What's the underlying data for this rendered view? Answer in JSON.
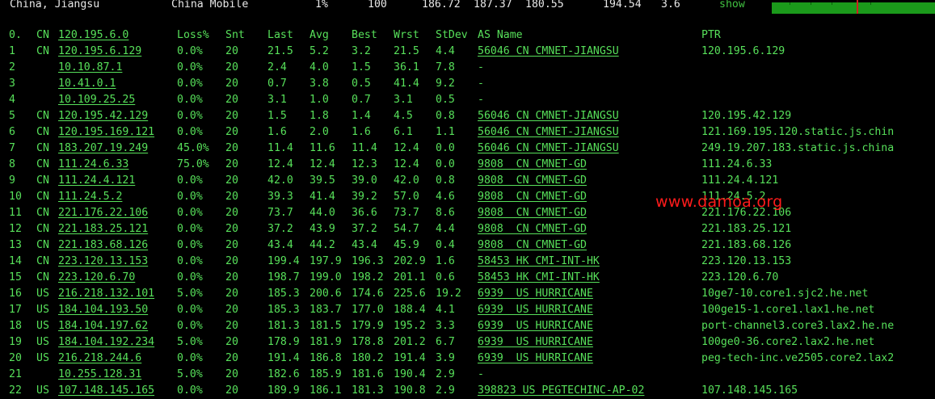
{
  "top_row": {
    "location": "China, Jiangsu",
    "isp": "China Mobile",
    "loss": "1%",
    "sent": "100",
    "avg": "186.72",
    "best": "187.37",
    "worst": "180.55",
    "last": "194.54",
    "stdev": "3.6",
    "show_link": "show"
  },
  "header": {
    "hop": "0.",
    "cc": "CN",
    "host": "120.195.6.0",
    "loss": "Loss%",
    "snt": "Snt",
    "last": "Last",
    "avg": "Avg",
    "best": "Best",
    "wrst": "Wrst",
    "stdev": "StDev",
    "as_name": "AS Name",
    "ptr": "PTR"
  },
  "hops": [
    {
      "hop": "1",
      "cc": "CN",
      "host": "120.195.6.129",
      "loss": "0.0%",
      "snt": "20",
      "last": "21.5",
      "avg": "5.2",
      "best": "3.2",
      "wrst": "21.5",
      "stdev": "4.4",
      "as_name": "56046 CN CMNET-JIANGSU",
      "ptr": "120.195.6.129"
    },
    {
      "hop": "2",
      "cc": "",
      "host": "10.10.87.1",
      "loss": "0.0%",
      "snt": "20",
      "last": "2.4",
      "avg": "4.0",
      "best": "1.5",
      "wrst": "36.1",
      "stdev": "7.8",
      "as_name": "-",
      "ptr": ""
    },
    {
      "hop": "3",
      "cc": "",
      "host": "10.41.0.1",
      "loss": "0.0%",
      "snt": "20",
      "last": "0.7",
      "avg": "3.8",
      "best": "0.5",
      "wrst": "41.4",
      "stdev": "9.2",
      "as_name": "-",
      "ptr": ""
    },
    {
      "hop": "4",
      "cc": "",
      "host": "10.109.25.25",
      "loss": "0.0%",
      "snt": "20",
      "last": "3.1",
      "avg": "1.0",
      "best": "0.7",
      "wrst": "3.1",
      "stdev": "0.5",
      "as_name": "-",
      "ptr": ""
    },
    {
      "hop": "5",
      "cc": "CN",
      "host": "120.195.42.129",
      "loss": "0.0%",
      "snt": "20",
      "last": "1.5",
      "avg": "1.8",
      "best": "1.4",
      "wrst": "4.5",
      "stdev": "0.8",
      "as_name": "56046 CN CMNET-JIANGSU",
      "ptr": "120.195.42.129"
    },
    {
      "hop": "6",
      "cc": "CN",
      "host": "120.195.169.121",
      "loss": "0.0%",
      "snt": "20",
      "last": "1.6",
      "avg": "2.0",
      "best": "1.6",
      "wrst": "6.1",
      "stdev": "1.1",
      "as_name": "56046 CN CMNET-JIANGSU",
      "ptr": "121.169.195.120.static.js.chin"
    },
    {
      "hop": "7",
      "cc": "CN",
      "host": "183.207.19.249",
      "loss": "45.0%",
      "snt": "20",
      "last": "11.4",
      "avg": "11.6",
      "best": "11.4",
      "wrst": "12.4",
      "stdev": "0.0",
      "as_name": "56046 CN CMNET-JIANGSU",
      "ptr": "249.19.207.183.static.js.china"
    },
    {
      "hop": "8",
      "cc": "CN",
      "host": "111.24.6.33",
      "loss": "75.0%",
      "snt": "20",
      "last": "12.4",
      "avg": "12.4",
      "best": "12.3",
      "wrst": "12.4",
      "stdev": "0.0",
      "as_name": "9808  CN CMNET-GD",
      "ptr": "111.24.6.33"
    },
    {
      "hop": "9",
      "cc": "CN",
      "host": "111.24.4.121",
      "loss": "0.0%",
      "snt": "20",
      "last": "42.0",
      "avg": "39.5",
      "best": "39.0",
      "wrst": "42.0",
      "stdev": "0.8",
      "as_name": "9808  CN CMNET-GD",
      "ptr": "111.24.4.121"
    },
    {
      "hop": "10",
      "cc": "CN",
      "host": "111.24.5.2",
      "loss": "0.0%",
      "snt": "20",
      "last": "39.3",
      "avg": "41.4",
      "best": "39.2",
      "wrst": "57.0",
      "stdev": "4.6",
      "as_name": "9808  CN CMNET-GD",
      "ptr": "111.24.5.2"
    },
    {
      "hop": "11",
      "cc": "CN",
      "host": "221.176.22.106",
      "loss": "0.0%",
      "snt": "20",
      "last": "73.7",
      "avg": "44.0",
      "best": "36.6",
      "wrst": "73.7",
      "stdev": "8.6",
      "as_name": "9808  CN CMNET-GD",
      "ptr": "221.176.22.106"
    },
    {
      "hop": "12",
      "cc": "CN",
      "host": "221.183.25.121",
      "loss": "0.0%",
      "snt": "20",
      "last": "37.2",
      "avg": "43.9",
      "best": "37.2",
      "wrst": "54.7",
      "stdev": "4.4",
      "as_name": "9808  CN CMNET-GD",
      "ptr": "221.183.25.121"
    },
    {
      "hop": "13",
      "cc": "CN",
      "host": "221.183.68.126",
      "loss": "0.0%",
      "snt": "20",
      "last": "43.4",
      "avg": "44.2",
      "best": "43.4",
      "wrst": "45.9",
      "stdev": "0.4",
      "as_name": "9808  CN CMNET-GD",
      "ptr": "221.183.68.126"
    },
    {
      "hop": "14",
      "cc": "CN",
      "host": "223.120.13.153",
      "loss": "0.0%",
      "snt": "20",
      "last": "199.4",
      "avg": "197.9",
      "best": "196.3",
      "wrst": "202.9",
      "stdev": "1.6",
      "as_name": "58453 HK CMI-INT-HK",
      "ptr": "223.120.13.153"
    },
    {
      "hop": "15",
      "cc": "CN",
      "host": "223.120.6.70",
      "loss": "0.0%",
      "snt": "20",
      "last": "198.7",
      "avg": "199.0",
      "best": "198.2",
      "wrst": "201.1",
      "stdev": "0.6",
      "as_name": "58453 HK CMI-INT-HK",
      "ptr": "223.120.6.70"
    },
    {
      "hop": "16",
      "cc": "US",
      "host": "216.218.132.101",
      "loss": "5.0%",
      "snt": "20",
      "last": "185.3",
      "avg": "200.6",
      "best": "174.6",
      "wrst": "225.6",
      "stdev": "19.2",
      "as_name": "6939  US HURRICANE",
      "ptr": "10ge7-10.core1.sjc2.he.net"
    },
    {
      "hop": "17",
      "cc": "US",
      "host": "184.104.193.50",
      "loss": "0.0%",
      "snt": "20",
      "last": "185.3",
      "avg": "183.7",
      "best": "177.0",
      "wrst": "188.4",
      "stdev": "4.1",
      "as_name": "6939  US HURRICANE",
      "ptr": "100ge15-1.core1.lax1.he.net"
    },
    {
      "hop": "18",
      "cc": "US",
      "host": "184.104.197.62",
      "loss": "0.0%",
      "snt": "20",
      "last": "181.3",
      "avg": "181.5",
      "best": "179.9",
      "wrst": "195.2",
      "stdev": "3.3",
      "as_name": "6939  US HURRICANE",
      "ptr": "port-channel3.core3.lax2.he.ne"
    },
    {
      "hop": "19",
      "cc": "US",
      "host": "184.104.192.234",
      "loss": "5.0%",
      "snt": "20",
      "last": "178.9",
      "avg": "181.9",
      "best": "178.8",
      "wrst": "201.2",
      "stdev": "6.7",
      "as_name": "6939  US HURRICANE",
      "ptr": "100ge0-36.core2.lax2.he.net"
    },
    {
      "hop": "20",
      "cc": "US",
      "host": "216.218.244.6",
      "loss": "0.0%",
      "snt": "20",
      "last": "191.4",
      "avg": "186.8",
      "best": "180.2",
      "wrst": "191.4",
      "stdev": "3.9",
      "as_name": "6939  US HURRICANE",
      "ptr": "peg-tech-inc.ve2505.core2.lax2"
    },
    {
      "hop": "21",
      "cc": "",
      "host": "10.255.128.31",
      "loss": "5.0%",
      "snt": "20",
      "last": "182.6",
      "avg": "185.9",
      "best": "181.6",
      "wrst": "190.4",
      "stdev": "2.9",
      "as_name": "-",
      "ptr": ""
    },
    {
      "hop": "22",
      "cc": "US",
      "host": "107.148.145.165",
      "loss": "0.0%",
      "snt": "20",
      "last": "189.9",
      "avg": "186.1",
      "best": "181.3",
      "wrst": "190.8",
      "stdev": "2.9",
      "as_name": "398823 US PEGTECHINC-AP-02",
      "ptr": "107.148.145.165"
    }
  ],
  "watermark": "www.damoa.org",
  "colors": {
    "background": "#000000",
    "terminal_text": "#57e05a",
    "top_text": "#e8e8e8",
    "bar": "#1b9a1b",
    "bar_marker": "#d02020",
    "watermark": "#ff1b1b"
  }
}
